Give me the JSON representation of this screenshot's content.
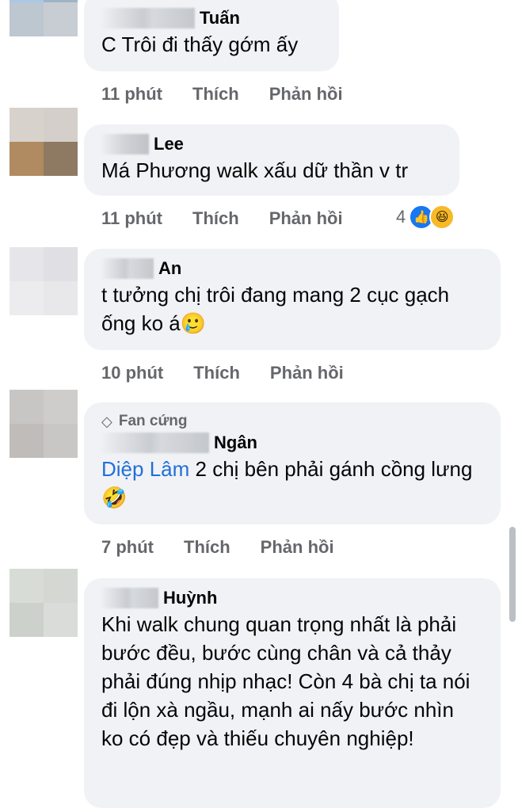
{
  "comments": [
    {
      "name": "Tuấn",
      "text": "C Trôi đi thấy gớm ấy",
      "time": "11 phút",
      "like": "Thích",
      "reply": "Phản hồi",
      "avatar_colors": [
        "#a8c8e6",
        "#9fb3c6",
        "#bcc7d0",
        "#c7cdd2"
      ]
    },
    {
      "name": "Lee",
      "text": "Má Phương walk xấu dữ thần v tr",
      "time": "11 phút",
      "like": "Thích",
      "reply": "Phản hồi",
      "reaction_count": "4",
      "reaction_icons": [
        "like-icon",
        "haha-icon"
      ],
      "avatar_colors": [
        "#d8d2cc",
        "#d4cfca",
        "#b08a60",
        "#8e7a62"
      ]
    },
    {
      "name": "An",
      "text": "t tưởng chị trôi đang mang 2 cục gạch ống ko á",
      "emoji": "🥲",
      "time": "10 phút",
      "like": "Thích",
      "reply": "Phản hồi",
      "avatar_colors": [
        "#e6e6ea",
        "#e0e0e4",
        "#ececef",
        "#e8e8eb"
      ]
    },
    {
      "badge": "Fan cứng",
      "name": "Ngân",
      "mention": "Diệp Lâm",
      "text": " 2 chị bên phải gánh cồng lưng",
      "emoji": "🤣",
      "time": "7 phút",
      "like": "Thích",
      "reply": "Phản hồi",
      "avatar_colors": [
        "#c8c6c4",
        "#cfcdcb",
        "#bfbcb9",
        "#c9c7c5"
      ]
    },
    {
      "name": "Huỳnh",
      "text": "Khi walk chung quan trọng nhất là phải bước đều, bước cùng chân và cả thảy phải đúng nhịp nhạc! Còn 4 bà chị ta nói đi lộn xà ngầu, mạnh ai nấy bước nhìn ko có đẹp và thiếu chuyên nghiệp!",
      "avatar_colors": [
        "#d7dcd6",
        "#d4d7d2",
        "#cdd1cc",
        "#d9dcd8"
      ]
    }
  ]
}
